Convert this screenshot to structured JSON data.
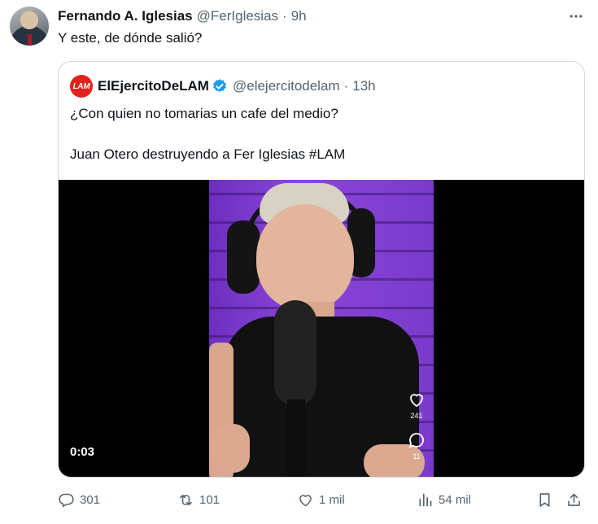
{
  "tweet": {
    "author_name": "Fernando A. Iglesias",
    "author_handle": "@FerIglesias",
    "separator": "·",
    "time": "9h",
    "text": "Y este, de dónde salió?"
  },
  "quote": {
    "avatar_text": "LAM",
    "author_name": "ElEjercitoDeLAM",
    "verified": true,
    "author_handle": "@elejercitodelam",
    "separator": "·",
    "time": "13h",
    "text_line1": "¿Con quien no tomarias un cafe del medio?",
    "text_line2": "Juan Otero destruyendo a Fer Iglesias #LAM",
    "video": {
      "elapsed": "0:03",
      "like_count": "241",
      "comment_count": "11"
    }
  },
  "actions": {
    "replies": "301",
    "reposts": "101",
    "likes": "1 mil",
    "views": "54 mil"
  },
  "colors": {
    "text_primary": "#0f1419",
    "text_secondary": "#536471",
    "border": "#cfd9de",
    "verified_blue": "#1d9bf0",
    "lam_red": "#e0231d"
  },
  "icons": [
    "more-icon",
    "verified-badge-icon",
    "heart-icon",
    "comment-icon",
    "reply-icon",
    "repost-icon",
    "like-icon",
    "views-icon",
    "bookmark-icon",
    "share-icon"
  ]
}
